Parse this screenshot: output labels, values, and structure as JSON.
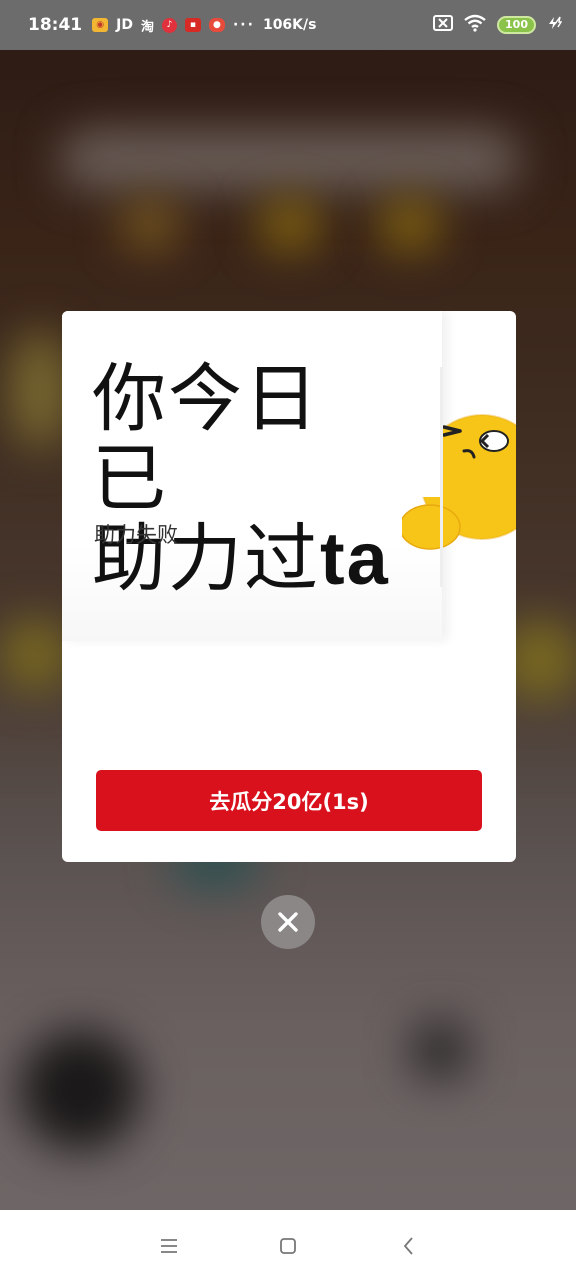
{
  "status_bar": {
    "time": "18:41",
    "app_icons": [
      "weibo-icon",
      "jd-icon",
      "taobao-icon",
      "music-icon",
      "news-icon",
      "game-icon"
    ],
    "jd_label": "JD",
    "taobao_label": "淘",
    "overflow": "···",
    "net_speed": "106K/s",
    "battery": "100"
  },
  "dialog": {
    "title_line1": "你今日已",
    "title_line2_cn": "助力过",
    "title_line2_en": "ta",
    "subtitle": "助力失败",
    "cta_label": "去瓜分20亿(1s)"
  },
  "colors": {
    "accent": "#d9111d",
    "mascot": "#f7c517"
  },
  "navbar": {
    "items": [
      "menu-icon",
      "home-icon",
      "back-icon"
    ]
  }
}
